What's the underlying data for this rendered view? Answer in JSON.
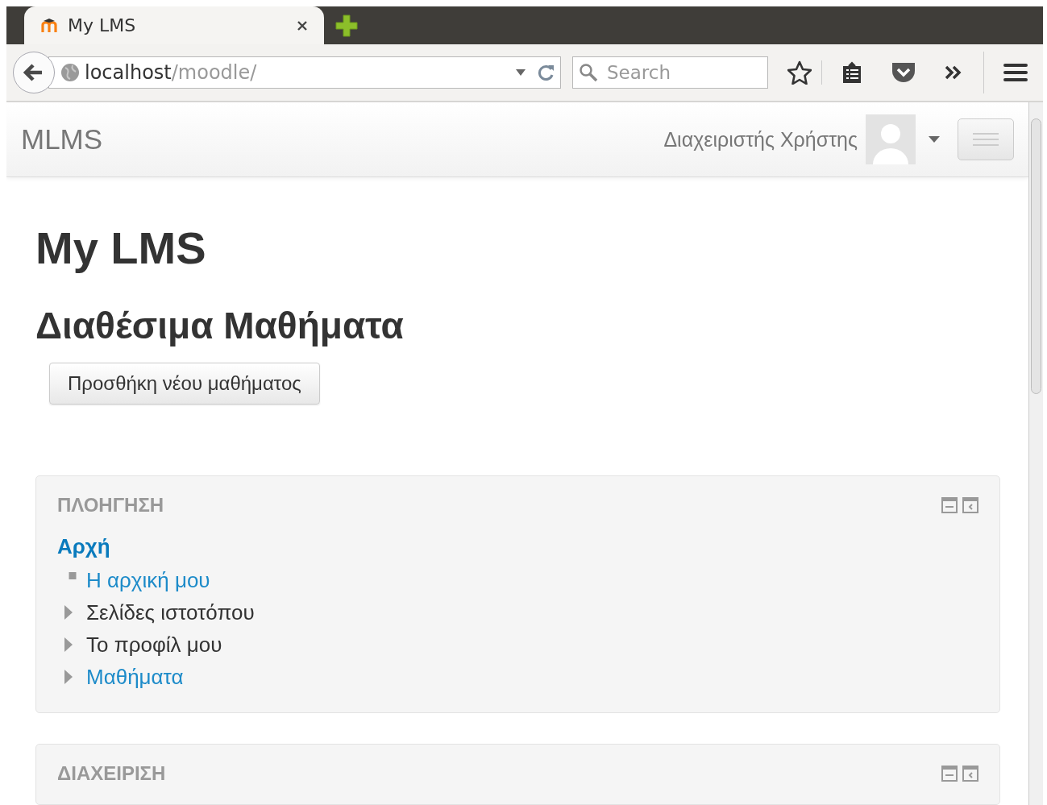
{
  "tab": {
    "title": "My LMS"
  },
  "toolbar": {
    "url_host": "localhost",
    "url_path": "/moodle/",
    "search_placeholder": "Search"
  },
  "navbar": {
    "brand": "MLMS",
    "user_name": "Διαχειριστής Χρήστης"
  },
  "page": {
    "site_title": "My LMS",
    "section_title": "Διαθέσιμα Μαθήματα",
    "add_button": "Προσθήκη νέου μαθήματος"
  },
  "blocks": [
    {
      "title": "ΠΛΟΗΓΗΣΗ",
      "root": "Αρχή",
      "items": [
        {
          "label": "Η αρχική μου",
          "kind": "leaf",
          "link": true
        },
        {
          "label": "Σελίδες ιστοτόπου",
          "kind": "branch",
          "link": false
        },
        {
          "label": "Το προφίλ μου",
          "kind": "branch",
          "link": false
        },
        {
          "label": "Μαθήματα",
          "kind": "branch",
          "link": true
        }
      ]
    },
    {
      "title": "ΔΙΑΧΕΙΡΙΣΗ"
    }
  ]
}
